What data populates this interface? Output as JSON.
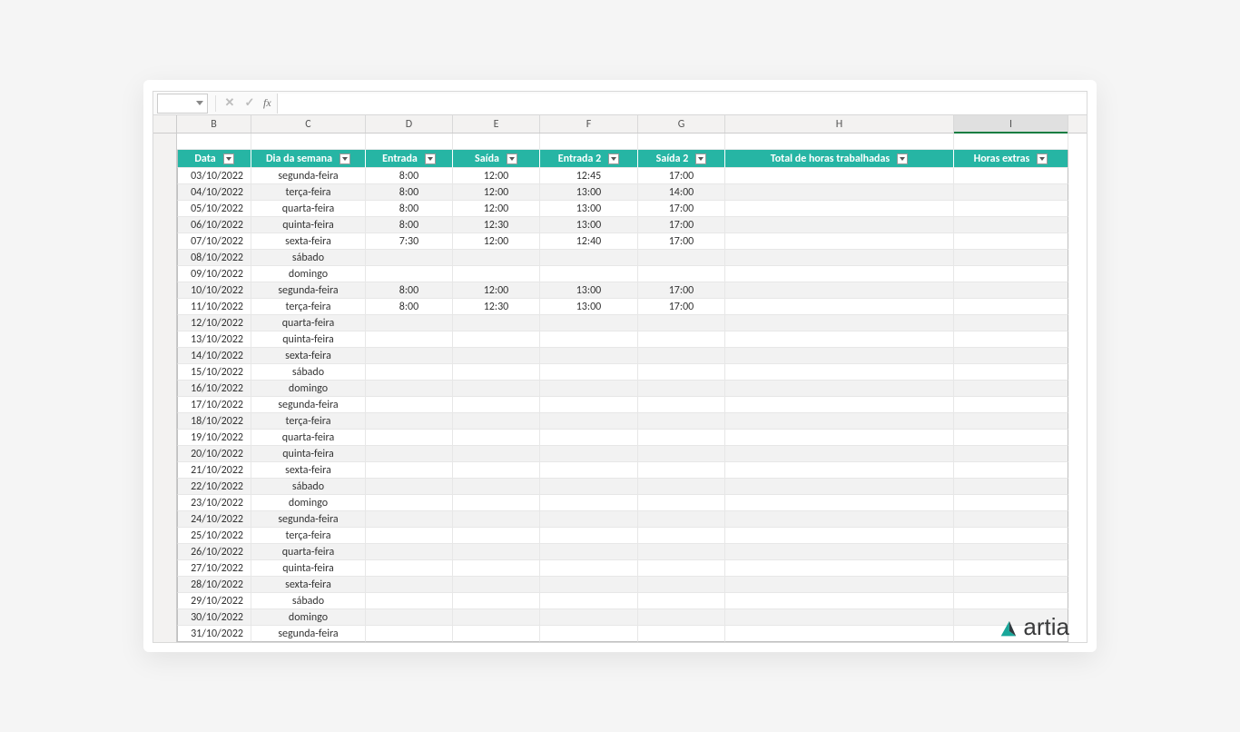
{
  "formula_bar": {
    "name_box": "",
    "fx_label": "fx",
    "value": ""
  },
  "columns": [
    {
      "letter": "B",
      "cls": "c-B"
    },
    {
      "letter": "C",
      "cls": "c-C"
    },
    {
      "letter": "D",
      "cls": "c-D"
    },
    {
      "letter": "E",
      "cls": "c-E"
    },
    {
      "letter": "F",
      "cls": "c-F"
    },
    {
      "letter": "G",
      "cls": "c-G"
    },
    {
      "letter": "H",
      "cls": "c-H"
    },
    {
      "letter": "I",
      "cls": "c-I",
      "active": true
    }
  ],
  "table": {
    "headers": [
      "Data",
      "Dia da semana",
      "Entrada",
      "Saída",
      "Entrada 2",
      "Saída 2",
      "Total de horas trabalhadas",
      "Horas extras"
    ],
    "rows": [
      {
        "data": "03/10/2022",
        "dia": "segunda-feira",
        "e1": "8:00",
        "s1": "12:00",
        "e2": "12:45",
        "s2": "17:00",
        "total": "",
        "extra": ""
      },
      {
        "data": "04/10/2022",
        "dia": "terça-feira",
        "e1": "8:00",
        "s1": "12:00",
        "e2": "13:00",
        "s2": "14:00",
        "total": "",
        "extra": ""
      },
      {
        "data": "05/10/2022",
        "dia": "quarta-feira",
        "e1": "8:00",
        "s1": "12:00",
        "e2": "13:00",
        "s2": "17:00",
        "total": "",
        "extra": ""
      },
      {
        "data": "06/10/2022",
        "dia": "quinta-feira",
        "e1": "8:00",
        "s1": "12:30",
        "e2": "13:00",
        "s2": "17:00",
        "total": "",
        "extra": ""
      },
      {
        "data": "07/10/2022",
        "dia": "sexta-feira",
        "e1": "7:30",
        "s1": "12:00",
        "e2": "12:40",
        "s2": "17:00",
        "total": "",
        "extra": ""
      },
      {
        "data": "08/10/2022",
        "dia": "sábado",
        "e1": "",
        "s1": "",
        "e2": "",
        "s2": "",
        "total": "",
        "extra": ""
      },
      {
        "data": "09/10/2022",
        "dia": "domingo",
        "e1": "",
        "s1": "",
        "e2": "",
        "s2": "",
        "total": "",
        "extra": ""
      },
      {
        "data": "10/10/2022",
        "dia": "segunda-feira",
        "e1": "8:00",
        "s1": "12:00",
        "e2": "13:00",
        "s2": "17:00",
        "total": "",
        "extra": ""
      },
      {
        "data": "11/10/2022",
        "dia": "terça-feira",
        "e1": "8:00",
        "s1": "12:30",
        "e2": "13:00",
        "s2": "17:00",
        "total": "",
        "extra": ""
      },
      {
        "data": "12/10/2022",
        "dia": "quarta-feira",
        "e1": "",
        "s1": "",
        "e2": "",
        "s2": "",
        "total": "",
        "extra": ""
      },
      {
        "data": "13/10/2022",
        "dia": "quinta-feira",
        "e1": "",
        "s1": "",
        "e2": "",
        "s2": "",
        "total": "",
        "extra": ""
      },
      {
        "data": "14/10/2022",
        "dia": "sexta-feira",
        "e1": "",
        "s1": "",
        "e2": "",
        "s2": "",
        "total": "",
        "extra": ""
      },
      {
        "data": "15/10/2022",
        "dia": "sábado",
        "e1": "",
        "s1": "",
        "e2": "",
        "s2": "",
        "total": "",
        "extra": ""
      },
      {
        "data": "16/10/2022",
        "dia": "domingo",
        "e1": "",
        "s1": "",
        "e2": "",
        "s2": "",
        "total": "",
        "extra": ""
      },
      {
        "data": "17/10/2022",
        "dia": "segunda-feira",
        "e1": "",
        "s1": "",
        "e2": "",
        "s2": "",
        "total": "",
        "extra": ""
      },
      {
        "data": "18/10/2022",
        "dia": "terça-feira",
        "e1": "",
        "s1": "",
        "e2": "",
        "s2": "",
        "total": "",
        "extra": ""
      },
      {
        "data": "19/10/2022",
        "dia": "quarta-feira",
        "e1": "",
        "s1": "",
        "e2": "",
        "s2": "",
        "total": "",
        "extra": ""
      },
      {
        "data": "20/10/2022",
        "dia": "quinta-feira",
        "e1": "",
        "s1": "",
        "e2": "",
        "s2": "",
        "total": "",
        "extra": ""
      },
      {
        "data": "21/10/2022",
        "dia": "sexta-feira",
        "e1": "",
        "s1": "",
        "e2": "",
        "s2": "",
        "total": "",
        "extra": ""
      },
      {
        "data": "22/10/2022",
        "dia": "sábado",
        "e1": "",
        "s1": "",
        "e2": "",
        "s2": "",
        "total": "",
        "extra": ""
      },
      {
        "data": "23/10/2022",
        "dia": "domingo",
        "e1": "",
        "s1": "",
        "e2": "",
        "s2": "",
        "total": "",
        "extra": ""
      },
      {
        "data": "24/10/2022",
        "dia": "segunda-feira",
        "e1": "",
        "s1": "",
        "e2": "",
        "s2": "",
        "total": "",
        "extra": ""
      },
      {
        "data": "25/10/2022",
        "dia": "terça-feira",
        "e1": "",
        "s1": "",
        "e2": "",
        "s2": "",
        "total": "",
        "extra": ""
      },
      {
        "data": "26/10/2022",
        "dia": "quarta-feira",
        "e1": "",
        "s1": "",
        "e2": "",
        "s2": "",
        "total": "",
        "extra": ""
      },
      {
        "data": "27/10/2022",
        "dia": "quinta-feira",
        "e1": "",
        "s1": "",
        "e2": "",
        "s2": "",
        "total": "",
        "extra": ""
      },
      {
        "data": "28/10/2022",
        "dia": "sexta-feira",
        "e1": "",
        "s1": "",
        "e2": "",
        "s2": "",
        "total": "",
        "extra": ""
      },
      {
        "data": "29/10/2022",
        "dia": "sábado",
        "e1": "",
        "s1": "",
        "e2": "",
        "s2": "",
        "total": "",
        "extra": ""
      },
      {
        "data": "30/10/2022",
        "dia": "domingo",
        "e1": "",
        "s1": "",
        "e2": "",
        "s2": "",
        "total": "",
        "extra": ""
      },
      {
        "data": "31/10/2022",
        "dia": "segunda-feira",
        "e1": "",
        "s1": "",
        "e2": "",
        "s2": "",
        "total": "",
        "extra": ""
      }
    ]
  },
  "logo_text": "artia"
}
